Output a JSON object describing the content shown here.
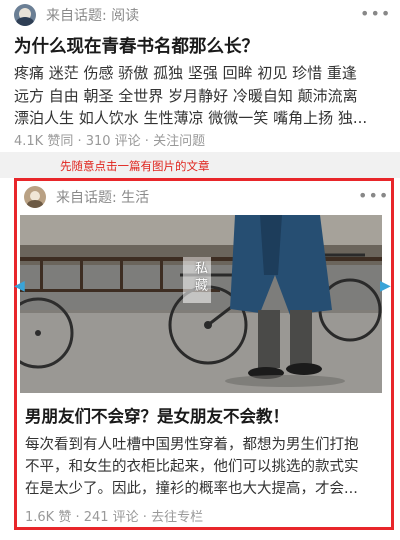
{
  "card1": {
    "topic": "来自话题: 阅读",
    "question": "为什么现在青春书名都那么长？",
    "excerpt_lines": [
      "疼痛 迷茫 伤感 骄傲 孤独 坚强 回眸 初见 珍惜 重逢",
      "远方 自由 朝圣 全世界 岁月静好 冷暖自知 颠沛流离",
      "漂泊人生 如人饮水 生性薄凉 微微一笑 嘴角上扬 独..."
    ],
    "meta": "4.1K 赞同 · 310 评论 · 关注问题",
    "more_icon": "•••"
  },
  "hint": "先随意点击一篇有图片的文章",
  "card2": {
    "topic": "来自话题: 生活",
    "more_icon": "•••",
    "image_caption": "私藏",
    "title": "男朋友们不会穿？是女朋友不会教！",
    "excerpt_lines": [
      "每次看到有人吐槽中国男性穿着，都想为男生们打抱",
      "不平，和女生的衣柜比起来，他们可以挑选的款式实",
      "在是太少了。因此，撞衫的概率也大大提高，才会..."
    ],
    "meta": "1.6K 赞 · 241 评论 · 去往专栏"
  },
  "colors": {
    "highlight_border": "#e8262a",
    "hint_text": "#e0261f",
    "meta_text": "#999999",
    "divider": "#f1f1f1"
  },
  "icons": [
    "avatar",
    "more-icon",
    "chevron-left-icon",
    "chevron-right-icon"
  ]
}
